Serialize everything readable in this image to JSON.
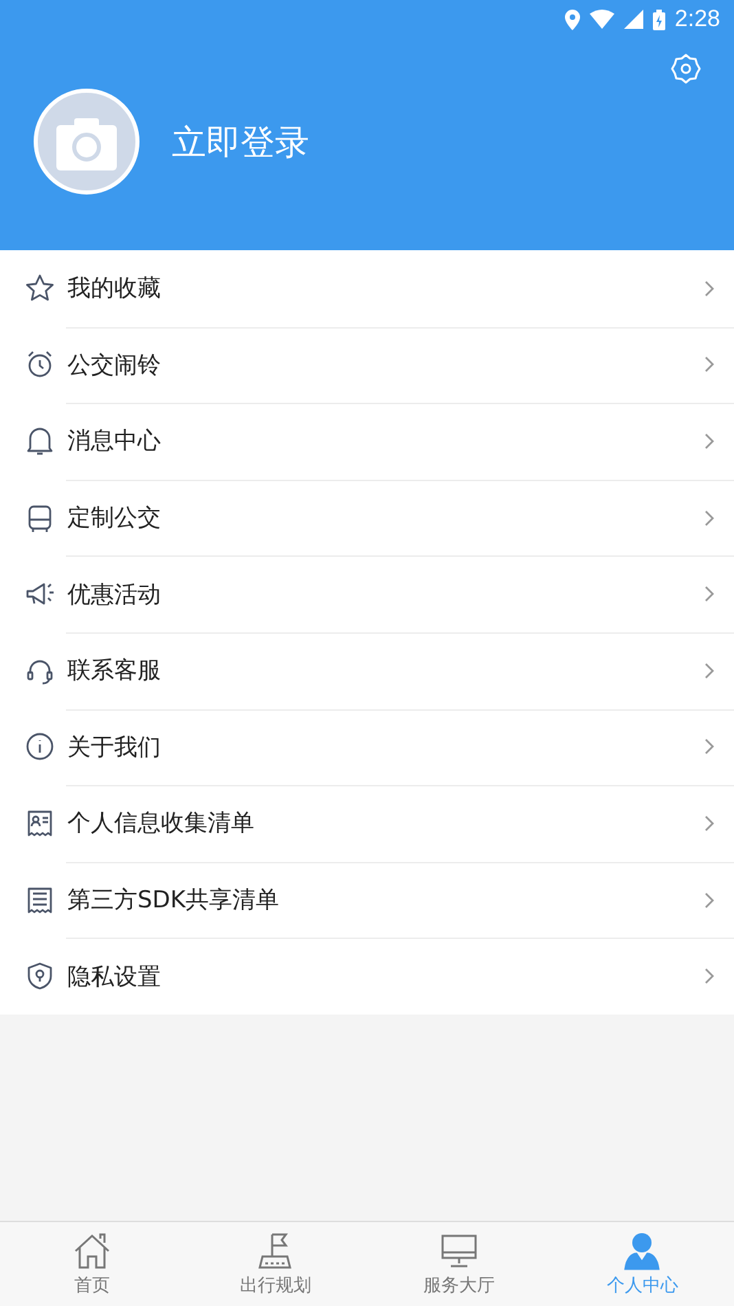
{
  "status_bar": {
    "time": "2:28"
  },
  "profile": {
    "login_label": "立即登录"
  },
  "menu": [
    {
      "kind": "star",
      "label": "我的收藏"
    },
    {
      "kind": "alarm",
      "label": "公交闹铃"
    },
    {
      "kind": "bell",
      "label": "消息中心"
    },
    {
      "kind": "bus",
      "label": "定制公交"
    },
    {
      "kind": "megaphone",
      "label": "优惠活动"
    },
    {
      "kind": "headset",
      "label": "联系客服"
    },
    {
      "kind": "info",
      "label": "关于我们"
    },
    {
      "kind": "idcard",
      "label": "个人信息收集清单"
    },
    {
      "kind": "sdk",
      "label": "第三方SDK共享清单"
    },
    {
      "kind": "shield",
      "label": "隐私设置"
    }
  ],
  "tabs": [
    {
      "kind": "home",
      "label": "首页",
      "selected": false
    },
    {
      "kind": "flag",
      "label": "出行规划",
      "selected": false
    },
    {
      "kind": "monitor",
      "label": "服务大厅",
      "selected": false
    },
    {
      "kind": "person",
      "label": "个人中心",
      "selected": true
    }
  ]
}
